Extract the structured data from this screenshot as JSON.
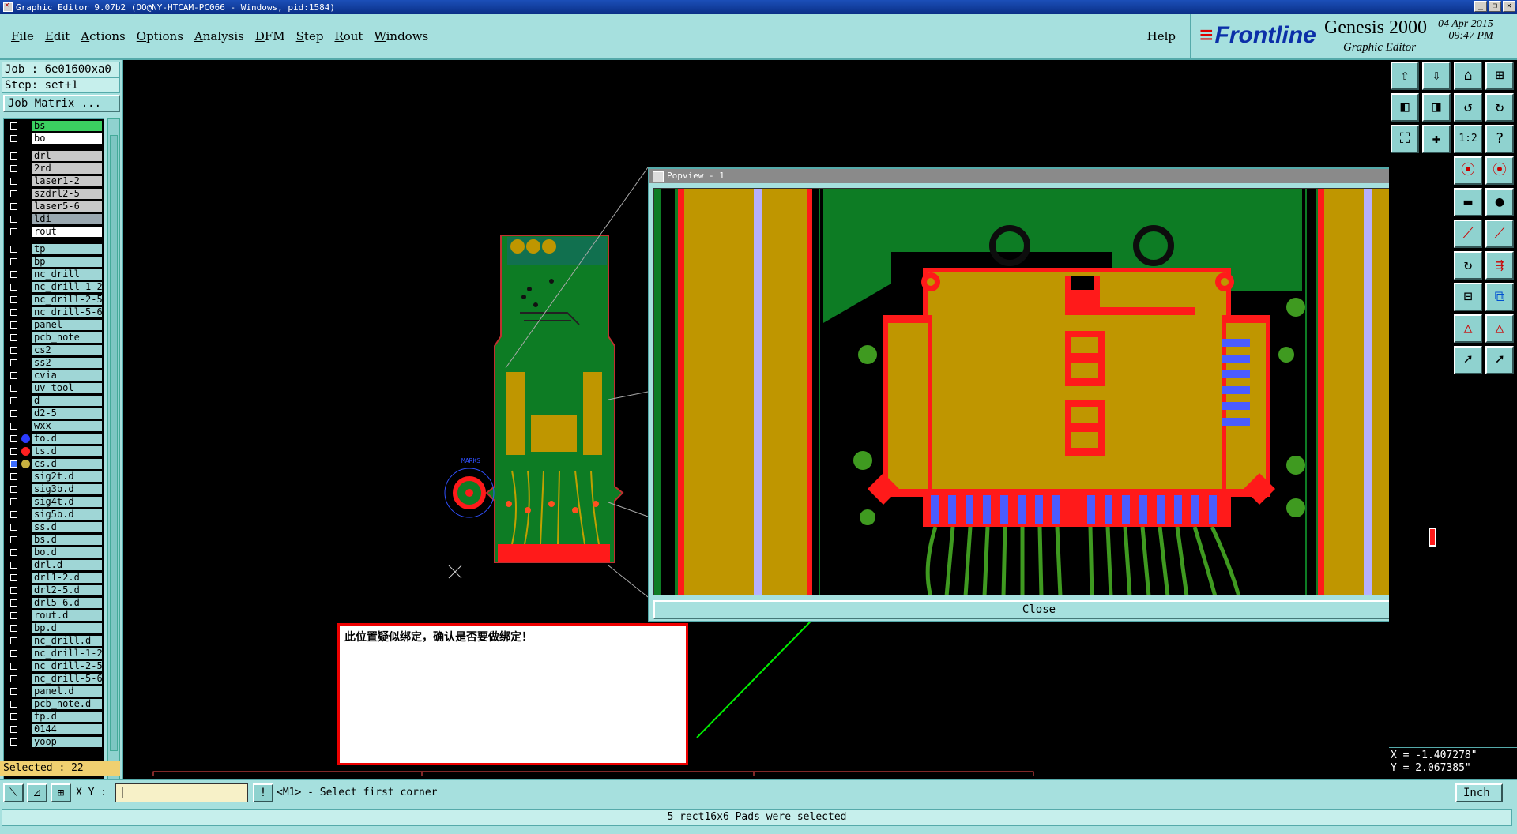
{
  "window": {
    "title": "Graphic Editor 9.07b2 (OO@NY-HTCAM-PC066 - Windows, pid:1584)"
  },
  "menu": [
    "File",
    "Edit",
    "Actions",
    "Options",
    "Analysis",
    "DFM",
    "Step",
    "Rout",
    "Windows"
  ],
  "help": "Help",
  "brand": {
    "logo": "Frontline",
    "product": "Genesis 2000",
    "subtitle": "Graphic Editor",
    "date": "04 Apr 2015",
    "time": "09:47 PM"
  },
  "job": {
    "job_line": "Job : 6e01600xa0",
    "step_line": "Step: set+1",
    "matrix_button": "Job Matrix ..."
  },
  "layers": [
    {
      "name": "bs",
      "style": "green"
    },
    {
      "name": "bo",
      "style": "white"
    },
    {
      "name": "drl",
      "style": "gray"
    },
    {
      "name": "2rd",
      "style": "gray"
    },
    {
      "name": "laser1-2",
      "style": "gray"
    },
    {
      "name": "szdrl2-5",
      "style": "gray"
    },
    {
      "name": "laser5-6",
      "style": "gray"
    },
    {
      "name": "ldi",
      "style": "dgray"
    },
    {
      "name": "rout",
      "style": "white"
    },
    {
      "name": "tp",
      "style": ""
    },
    {
      "name": "bp",
      "style": ""
    },
    {
      "name": "nc_drill",
      "style": ""
    },
    {
      "name": "nc_drill-1-2",
      "style": ""
    },
    {
      "name": "nc_drill-2-5",
      "style": ""
    },
    {
      "name": "nc_drill-5-6",
      "style": ""
    },
    {
      "name": "panel",
      "style": ""
    },
    {
      "name": "pcb_note",
      "style": ""
    },
    {
      "name": "cs2",
      "style": ""
    },
    {
      "name": "ss2",
      "style": ""
    },
    {
      "name": "cvia",
      "style": ""
    },
    {
      "name": "uv_tool",
      "style": ""
    },
    {
      "name": "d",
      "style": ""
    },
    {
      "name": "d2-5",
      "style": ""
    },
    {
      "name": "wxx",
      "style": ""
    },
    {
      "name": "to.d",
      "style": "",
      "dot": "#2b3cff"
    },
    {
      "name": "ts.d",
      "style": "",
      "dot": "#ff2020"
    },
    {
      "name": "cs.d",
      "style": "",
      "dot": "#c8b040",
      "checked": true
    },
    {
      "name": "sig2t.d",
      "style": ""
    },
    {
      "name": "sig3b.d",
      "style": ""
    },
    {
      "name": "sig4t.d",
      "style": ""
    },
    {
      "name": "sig5b.d",
      "style": ""
    },
    {
      "name": "ss.d",
      "style": ""
    },
    {
      "name": "bs.d",
      "style": ""
    },
    {
      "name": "bo.d",
      "style": ""
    },
    {
      "name": "drl.d",
      "style": ""
    },
    {
      "name": "drl1-2.d",
      "style": ""
    },
    {
      "name": "drl2-5.d",
      "style": ""
    },
    {
      "name": "drl5-6.d",
      "style": ""
    },
    {
      "name": "rout.d",
      "style": ""
    },
    {
      "name": "bp.d",
      "style": ""
    },
    {
      "name": "nc_drill.d",
      "style": ""
    },
    {
      "name": "nc_drill-1-2",
      "style": ""
    },
    {
      "name": "nc_drill-2-5",
      "style": ""
    },
    {
      "name": "nc_drill-5-6",
      "style": ""
    },
    {
      "name": "panel.d",
      "style": ""
    },
    {
      "name": "pcb_note.d",
      "style": ""
    },
    {
      "name": "tp.d",
      "style": ""
    },
    {
      "name": "0144",
      "style": ""
    },
    {
      "name": "yoop",
      "style": ""
    }
  ],
  "selected": "Selected : 22",
  "popview": {
    "title": "Popview - 1",
    "close_label": "Close"
  },
  "board": {
    "mark_label": "MARKS"
  },
  "note": "此位置疑似绑定，确认是否要做绑定！",
  "coords": {
    "x": "X = -1.407278\"",
    "y": "Y = 2.067385\""
  },
  "bottom": {
    "xy_label": "X Y :",
    "message": "<M1> - Select first corner",
    "unit": "Inch"
  },
  "status": "5 rect16x6 Pads were selected",
  "colors": {
    "panel": "#a6e0de",
    "copper": "#bf9600",
    "board": "#0d7c24",
    "pad": "#ff1a1a",
    "accent_blue": "#4a5cff"
  }
}
